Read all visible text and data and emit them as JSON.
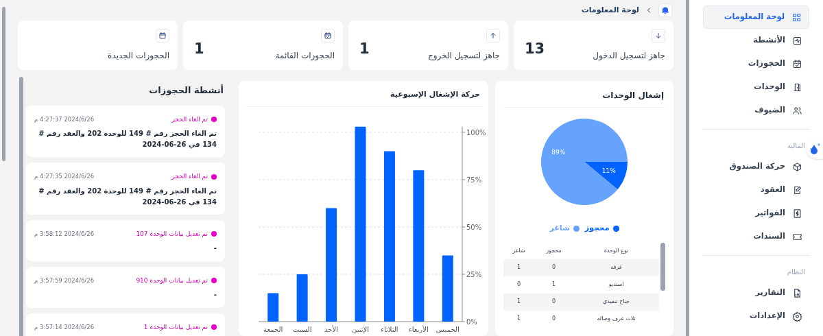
{
  "breadcrumb": {
    "current": "لوحة المعلومات"
  },
  "stats": [
    {
      "label": "جاهز لتسجيل الدخول",
      "value": "13"
    },
    {
      "label": "جاهز لتسجيل الخروج",
      "value": "1"
    },
    {
      "label": "الحجوزات القائمة",
      "value": "1"
    },
    {
      "label": "الحجوزات الجديدة"
    }
  ],
  "units_card": {
    "title": "إشغال الوحدات",
    "chart_data": {
      "type": "pie",
      "categories": [
        "محجوز",
        "شاغر"
      ],
      "series": [
        {
          "values": [
            11,
            89
          ]
        }
      ],
      "colors": [
        "#0062ff",
        "#66a3ff"
      ],
      "value_labels": [
        "11%",
        "89%"
      ]
    },
    "table": {
      "columns": [
        "نوع الوحدة",
        "محجوز",
        "شاغر"
      ],
      "rows": [
        [
          "غرفة",
          "0",
          "1"
        ],
        [
          "استديو",
          "1",
          "0"
        ],
        [
          "جناح تنفيذي",
          "0",
          "1"
        ],
        [
          "ثلاث غرف وصاله",
          "0",
          "1"
        ]
      ]
    }
  },
  "weekly_card": {
    "title": "حركة الإشغال الإسبوعية",
    "chart_data": {
      "type": "bar",
      "categories": [
        "الجمعة",
        "السبت",
        "الأحد",
        "الإثنين",
        "الثلاثاء",
        "الأربعاء",
        "الخميس"
      ],
      "series": [
        {
          "color": "#0062ff",
          "values": [
            15,
            25,
            60,
            103,
            90,
            80,
            35
          ]
        }
      ],
      "ylim": [
        0,
        103
      ],
      "grid": true,
      "yticks": [
        {
          "value": 0,
          "label": "0%"
        },
        {
          "value": 25,
          "label": "25%"
        },
        {
          "value": 50,
          "label": "50%"
        },
        {
          "value": 75,
          "label": "75%"
        },
        {
          "value": 100,
          "label": "100%"
        }
      ]
    }
  },
  "activities": {
    "title": "أنشطة الحجوزات",
    "items": [
      {
        "title": "تم الغاء الحجز",
        "time": "2024/6/26 4:27:37 م",
        "body": "تم الغاء الحجز رقم # 149 للوحدة 202 والعقد رقم # 134 في 26-06-2024"
      },
      {
        "title": "تم الغاء الحجز",
        "time": "2024/6/26 4:27:35 م",
        "body": "تم الغاء الحجز رقم # 149 للوحدة 202 والعقد رقم # 134 في 26-06-2024"
      },
      {
        "title": "تم تعديل بيانات الوحدة 107",
        "time": "2024/6/26 3:58:12 م",
        "body": "-"
      },
      {
        "title": "تم تعديل بيانات الوحدة 910",
        "time": "2024/6/26 3:57:59 م",
        "body": "-"
      },
      {
        "title": "تم تعديل بيانات الوحدة 1",
        "time": "2024/6/26 3:57:14 م"
      }
    ]
  },
  "sidebar": {
    "groups": [
      {
        "items": [
          {
            "label": "لوحة المعلومات",
            "selected": true
          },
          {
            "label": "الأنشطة",
            "selected": false
          },
          {
            "label": "الحجوزات",
            "selected": false
          },
          {
            "label": "الوحدات",
            "selected": false
          },
          {
            "label": "الضيوف",
            "selected": false
          }
        ]
      },
      {
        "heading": "المالية",
        "items": [
          {
            "label": "حركة الصندوق",
            "selected": false
          },
          {
            "label": "العقود",
            "selected": false
          },
          {
            "label": "الفواتير",
            "selected": false
          },
          {
            "label": "السندات",
            "selected": false
          }
        ]
      },
      {
        "heading": "النظام",
        "items": [
          {
            "label": "التقارير",
            "selected": false
          },
          {
            "label": "الإعدادات",
            "selected": false
          }
        ]
      }
    ]
  }
}
